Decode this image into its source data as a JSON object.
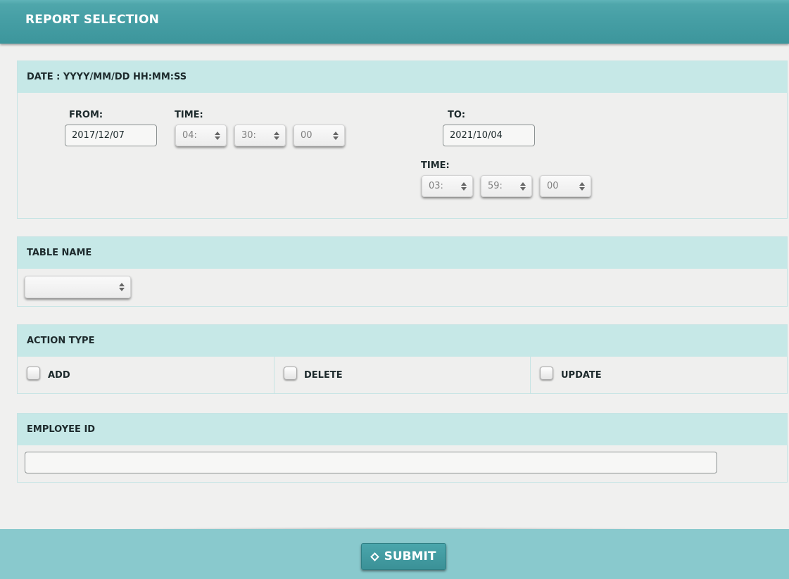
{
  "header": {
    "title": "REPORT SELECTION"
  },
  "date_section": {
    "heading": "DATE : YYYY/MM/DD HH:MM:SS",
    "from_label": "FROM:",
    "from_date": "2017/12/07",
    "from_time_label": "TIME:",
    "from_hour": "04:",
    "from_minute": "30:",
    "from_second": "00",
    "to_label": "TO:",
    "to_date": "2021/10/04",
    "to_time_label": "TIME:",
    "to_hour": "03:",
    "to_minute": "59:",
    "to_second": "00"
  },
  "table_section": {
    "heading": "TABLE NAME",
    "selected": ""
  },
  "action_section": {
    "heading": "ACTION TYPE",
    "options": [
      {
        "label": "ADD",
        "checked": false
      },
      {
        "label": "DELETE",
        "checked": false
      },
      {
        "label": "UPDATE",
        "checked": false
      }
    ]
  },
  "employee_section": {
    "heading": "EMPLOYEE ID",
    "value": ""
  },
  "footer": {
    "submit_label": "SUBMIT"
  },
  "colors": {
    "header": "#47a0a6",
    "section_head": "#c6e8e7",
    "footer": "#89c9cd",
    "button": "#3b9197"
  }
}
